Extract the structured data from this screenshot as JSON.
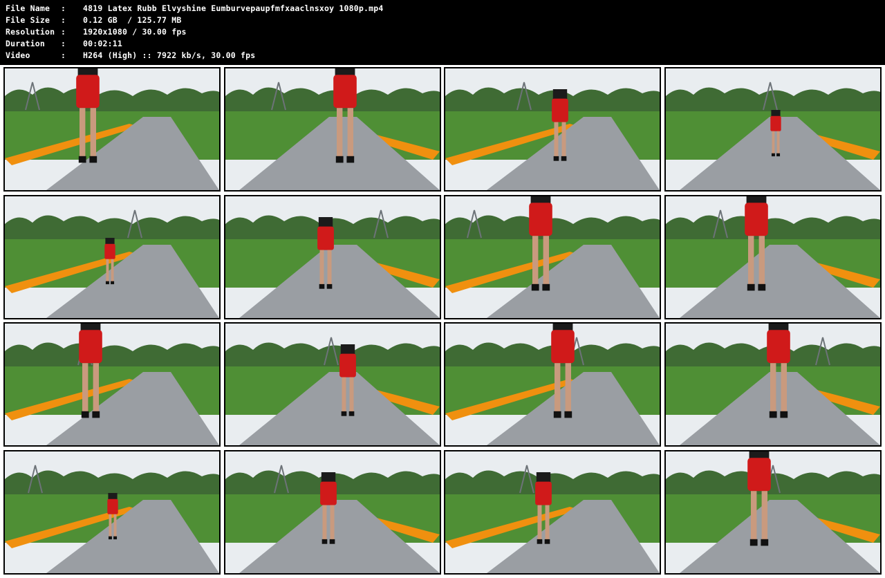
{
  "file_info": {
    "rows": [
      {
        "label": "File Name",
        "value": "4819 Latex Rubb Elvyshine Eumburvepaupfmfxaaclnsxoy 1080p.mp4"
      },
      {
        "label": "File Size",
        "value": "0.12 GB  / 125.77 MB"
      },
      {
        "label": "Resolution",
        "value": "1920x1080 / 30.00 fps"
      },
      {
        "label": "Duration",
        "value": "00:02:11"
      },
      {
        "label": "Video",
        "value": "H264 (High) :: 7922 kb/s, 30.00 fps"
      }
    ]
  },
  "thumbnails": [
    {
      "id": 1,
      "variant": "legs-close"
    },
    {
      "id": 2,
      "variant": "legs-close"
    },
    {
      "id": 3,
      "variant": "walk-mid"
    },
    {
      "id": 4,
      "variant": "walk-far"
    },
    {
      "id": 5,
      "variant": "walk-far"
    },
    {
      "id": 6,
      "variant": "walk-mid"
    },
    {
      "id": 7,
      "variant": "legs-close"
    },
    {
      "id": 8,
      "variant": "legs-close"
    },
    {
      "id": 9,
      "variant": "legs-close"
    },
    {
      "id": 10,
      "variant": "walk-mid"
    },
    {
      "id": 11,
      "variant": "legs-close"
    },
    {
      "id": 12,
      "variant": "legs-close"
    },
    {
      "id": 13,
      "variant": "walk-far"
    },
    {
      "id": 14,
      "variant": "walk-mid"
    },
    {
      "id": 15,
      "variant": "walk-mid"
    },
    {
      "id": 16,
      "variant": "front-close"
    }
  ],
  "colors": {
    "sky": "#e9edf0",
    "trees": "#3f6b34",
    "grass": "#4f8f35",
    "flowers": "#f0900f",
    "path": "#9a9ea3",
    "skirt": "#d01a1a",
    "top": "#1b1b1b",
    "skin": "#c99a7e"
  }
}
